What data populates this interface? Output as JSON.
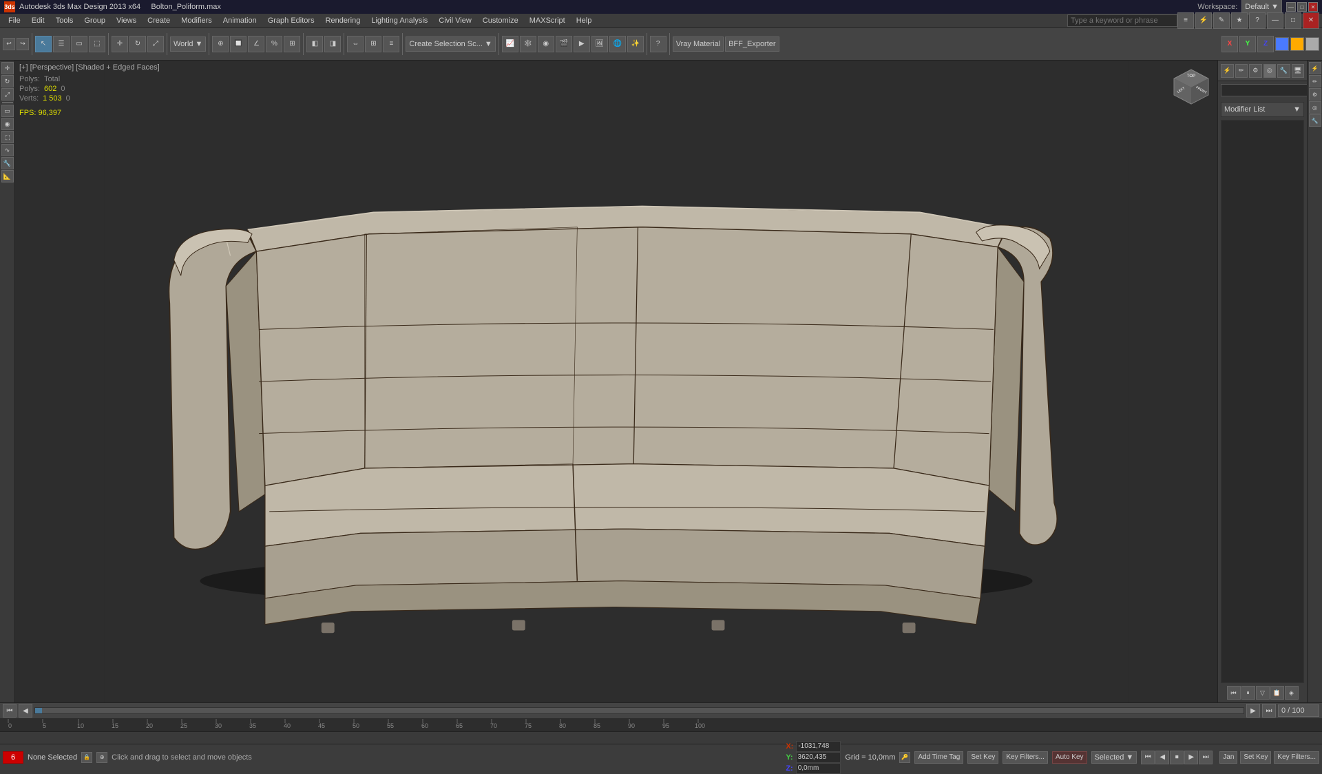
{
  "titleBar": {
    "appName": "Autodesk 3ds Max Design 2013 x64",
    "fileName": "Bolton_Poliform.max",
    "workspaceLabel": "Workspace:",
    "workspaceValue": "Default",
    "windowControls": [
      "—",
      "□",
      "✕"
    ]
  },
  "menuBar": {
    "items": [
      "File",
      "Edit",
      "Tools",
      "Group",
      "Views",
      "Create",
      "Modifiers",
      "Animation",
      "Graph Editors",
      "Rendering",
      "Lighting Analysis",
      "Civil View",
      "Customize",
      "MAXScript",
      "Help"
    ]
  },
  "toolbar": {
    "worldLabel": "World",
    "createSelectionLabel": "Create Selection Sc...",
    "vrayMaterialLabel": "Vray Material",
    "bffExporterLabel": "BFF_Exporter",
    "axes": [
      "X",
      "Y",
      "Z"
    ],
    "searchPlaceholder": "Type a keyword or phrase"
  },
  "viewport": {
    "header": "[+] [Perspective] [Shaded + Edged Faces]",
    "stats": {
      "polysLabel": "Polys:",
      "polysTotal": "602",
      "polysSelected": "0",
      "vertsLabel": "Verts:",
      "vertsTotal": "1 503",
      "vertsSelected": "0",
      "fpsLabel": "FPS:",
      "fpsValue": "96,397"
    }
  },
  "rightPanel": {
    "modifierListLabel": "Modifier List",
    "icons": [
      "⚡",
      "✏",
      "⚙",
      "◎",
      "🔧",
      "📋",
      "◈"
    ]
  },
  "timeline": {
    "frameRange": "0 / 100",
    "currentFrame": "6",
    "markers": [
      "0",
      "5",
      "10",
      "15",
      "20",
      "25",
      "30",
      "35",
      "40",
      "45",
      "50",
      "55",
      "60",
      "65",
      "70",
      "75",
      "80",
      "85",
      "90",
      "95",
      "100"
    ]
  },
  "statusBar": {
    "noneSelected": "None Selected",
    "clickDragHelp": "Click and drag to select and move objects",
    "xLabel": "X:",
    "xValue": "-1031,748",
    "yLabel": "Y:",
    "yValue": "3620,435",
    "zLabel": "Z:",
    "zValue": "0,0mm",
    "gridLabel": "Grid = 10,0mm",
    "addTimeTag": "Add Time Tag",
    "setKey": "Set Key",
    "keyFilters": "Key Filters...",
    "autoKey": "Auto Key",
    "selectedLabel": "Selected",
    "selectedValue": "Selected",
    "jan": "Jan",
    "setKeyLabel": "Set Key",
    "keyFiltersLabel": "Key Filters...",
    "playback": {
      "toStart": "⏮",
      "prevFrame": "◀",
      "play": "▶",
      "nextFrame": "▶",
      "toEnd": "⏭"
    }
  },
  "icons": {
    "app": "3ds",
    "search": "🔍",
    "gear": "⚙",
    "lock": "🔒",
    "nav-cube": "cube"
  }
}
